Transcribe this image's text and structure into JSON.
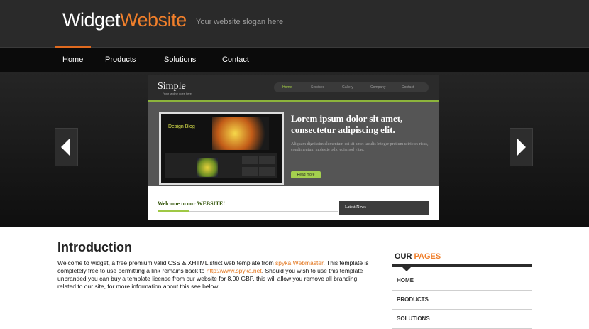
{
  "header": {
    "logo_part1": "Widget",
    "logo_part2": "Website",
    "slogan": "Your website slogan here"
  },
  "nav": {
    "items": [
      {
        "label": "Home",
        "active": true
      },
      {
        "label": "Products"
      },
      {
        "label": "Solutions"
      },
      {
        "label": "Contact"
      }
    ]
  },
  "banner": {
    "slide": {
      "logo": "Simple",
      "tagline": "Your tagline goes here",
      "menu": [
        "Home",
        "Services",
        "Gallery",
        "Company",
        "Contact"
      ],
      "screen_title": "Design Blog",
      "headline": "Lorem ipsum dolor sit amet, consectetur adipiscing elit.",
      "body": "Aliquam dignissim elementum est sit amet iaculis Integer pretium ultricies risus, condimentum molestie odio euismod vitae.",
      "button": "Read more",
      "welcome": "Welcome to our WEBSITE!",
      "news": "Latest News"
    }
  },
  "intro": {
    "title": "Introduction",
    "text1": "Welcome to widget, a free premium valid CSS & XHTML strict web template from ",
    "link1": "spyka Webmaster",
    "text2": ". This template is completely free to use permitting a link remains back to ",
    "link2": "http://www.spyka.net",
    "text3": ". Should you wish to use this template unbranded you can buy a template license from our website for 8.00 GBP, this will allow you remove all branding related to our site, for more information about this see below."
  },
  "sidebar": {
    "title_part1": "OUR",
    "title_part2": "PAGES",
    "items": [
      "HOME",
      "PRODUCTS",
      "SOLUTIONS"
    ]
  },
  "colors": {
    "accent": "#f07f2b",
    "header_bg": "#2a2a2a",
    "nav_bg": "#0b0b0b"
  }
}
